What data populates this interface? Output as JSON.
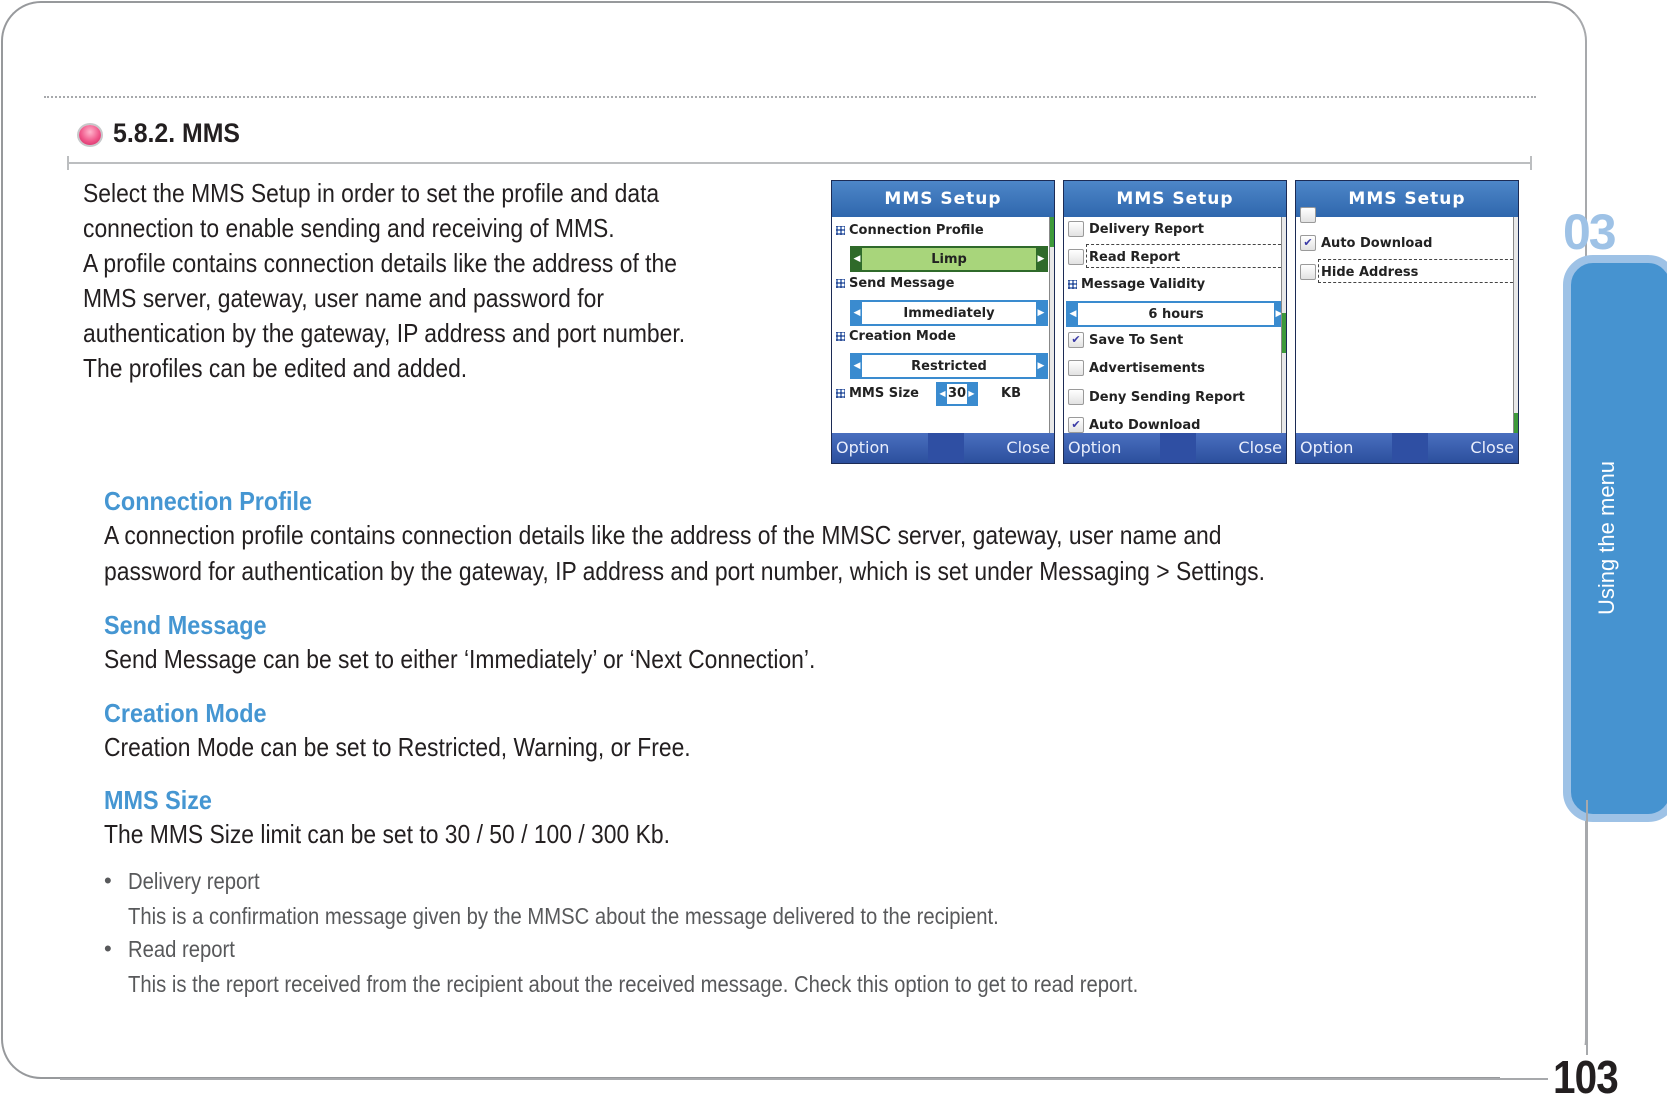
{
  "section": {
    "number_title": "5.8.2. MMS"
  },
  "intro": {
    "lines": [
      "Select the MMS Setup in order to set the profile and data",
      "connection to enable sending and receiving of MMS.",
      "A profile contains connection details like the address of the",
      "MMS server, gateway, user name and password for",
      "authentication by the gateway, IP address and port number.",
      "The profiles can be edited and added."
    ]
  },
  "phones": [
    {
      "title": "MMS Setup",
      "softkey_left": "Option",
      "softkey_right": "Close",
      "items": {
        "connection_profile_label": "Connection Profile",
        "connection_profile_value": "Limp",
        "send_message_label": "Send Message",
        "send_message_value": "Immediately",
        "creation_mode_label": "Creation Mode",
        "creation_mode_value": "Restricted",
        "mms_size_label": "MMS Size",
        "mms_size_value": "30",
        "mms_size_unit": "KB"
      }
    },
    {
      "title": "MMS Setup",
      "softkey_left": "Option",
      "softkey_right": "Close",
      "items": {
        "delivery_report": "Delivery Report",
        "delivery_report_checked": false,
        "read_report": "Read Report",
        "read_report_checked": false,
        "message_validity_label": "Message Validity",
        "message_validity_value": "6 hours",
        "save_to_sent": "Save To Sent",
        "save_to_sent_checked": true,
        "advertisements": "Advertisements",
        "advertisements_checked": false,
        "deny_sending_report": "Deny Sending Report",
        "deny_sending_report_checked": false,
        "auto_download_partial": "Auto Download"
      }
    },
    {
      "title": "MMS Setup",
      "softkey_left": "Option",
      "softkey_right": "Close",
      "items": {
        "auto_download": "Auto Download",
        "auto_download_checked": true,
        "hide_address": "Hide Address",
        "hide_address_checked": false
      }
    }
  ],
  "features": [
    {
      "title": "Connection Profile",
      "desc": [
        "A connection profile contains connection details like the address of the MMSC server, gateway, user name and",
        "password for authentication by the gateway, IP address and port number, which is set under Messaging > Settings."
      ]
    },
    {
      "title": "Send Message",
      "desc": [
        "Send Message can be set to either ‘Immediately’ or ‘Next Connection’."
      ]
    },
    {
      "title": "Creation Mode",
      "desc": [
        "Creation Mode can be set to Restricted, Warning, or Free."
      ]
    },
    {
      "title": "MMS Size",
      "desc": [
        "The MMS Size limit can be set to 30 / 50 / 100 / 300 Kb."
      ]
    }
  ],
  "notes": [
    {
      "bullet": "•",
      "title": "Delivery report",
      "desc": "This is a confirmation message given by the MMSC about the message delivered to the recipient."
    },
    {
      "bullet": "•",
      "title": "Read report",
      "desc": "This is the report received from the recipient about the received message. Check this option to get to read report."
    }
  ],
  "side_tab": {
    "chapter": "03",
    "label": "Using the menu"
  },
  "page": {
    "number": "103"
  },
  "colors": {
    "accent_blue": "#4596d2",
    "tab_blue": "#4693d0",
    "tab_border": "#9ec2e6",
    "bullet_pink": "#f0568a"
  }
}
